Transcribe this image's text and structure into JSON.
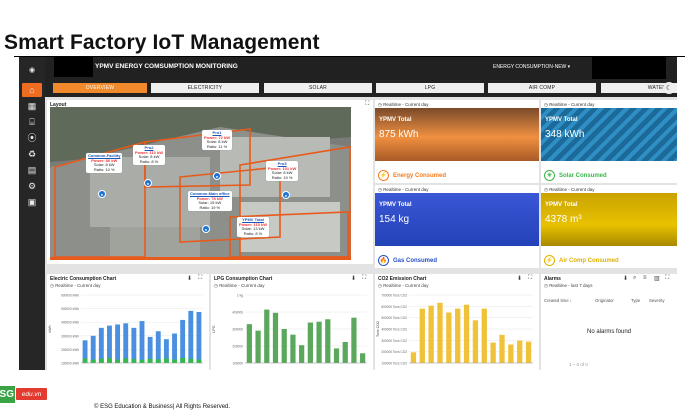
{
  "slide": {
    "title": "Smart Factory IoT Management",
    "footer": "© ESG Education & Business| All Rights Reserved.",
    "logo_sg": "SG",
    "logo_edu": "edu.vn"
  },
  "topbar": {
    "title": "YPMV ENERGY COMSUMPTION MONITORING",
    "dropdown": "ENERGY CONSUMPTION-NEW ▾",
    "menu": "⋮"
  },
  "tabs": [
    {
      "label": "OVERVIEW"
    },
    {
      "label": "ELECTRICITY"
    },
    {
      "label": "SOLAR"
    },
    {
      "label": "LPG"
    },
    {
      "label": "AIR COMP"
    },
    {
      "label": "WATER"
    }
  ],
  "layout": {
    "title": "Layout",
    "expand": "⛶"
  },
  "sites": [
    {
      "name": "Pro1",
      "lines": [
        "Power: 72 kW",
        "Solar: 8 kW",
        "Ratio: 11 %"
      ]
    },
    {
      "name": "Pro2",
      "lines": [
        "Power: 110 kW",
        "Solar: 8 kW",
        "Ratio: 8 %"
      ]
    },
    {
      "name": "Common-Facility",
      "lines": [
        "Power: 80 kW",
        "Solar: 8 kW",
        "Ratio: 10 %"
      ]
    },
    {
      "name": "Pro3",
      "lines": [
        "Power: 101 kW",
        "Solar: 8 kW",
        "Ratio: 19 %"
      ]
    },
    {
      "name": "Common-Main office",
      "lines": [
        "Power: 78 kW",
        "Solar: 15 kW",
        "Ratio: 19 %"
      ]
    },
    {
      "name": "YPMV Total",
      "lines": [
        "Power: 115 kW",
        "Solar: 13 kW",
        "Ratio: 8 %"
      ]
    }
  ],
  "tiles": [
    {
      "head": "Realtime - Current day",
      "title": "YPMV Total",
      "value": "875 kWh",
      "footer": "Energy Consumed",
      "color": "#f57c1e",
      "icon": "⚡"
    },
    {
      "head": "Realtime - Current day",
      "title": "YPMV Total",
      "value": "348 kWh",
      "footer": "Solar Consumed",
      "color": "#3cb54a",
      "icon": "☀"
    },
    {
      "head": "Realtime - Current day",
      "title": "YPMV Total",
      "value": "154 kg",
      "footer": "Gas Consumed",
      "color": "#2450c8",
      "icon": "🔥"
    },
    {
      "head": "Realtime - Current day",
      "title": "YPMV Total",
      "value": "4378 m³",
      "footer": "Air Comp Consumed",
      "color": "#f2c200",
      "icon": "⚡"
    }
  ],
  "charts": {
    "realtime_label": "Realtime - Current day",
    "elec": {
      "title": "Electric Consumption Chart",
      "ylabel": "kWh"
    },
    "lpg": {
      "title": "LPG Consumption Chart",
      "ylabel": "LPG"
    },
    "co2": {
      "title": "CO2 Emission Chart",
      "ylabel": "Tons CO2"
    },
    "download": "⬇",
    "fullscreen": "⛶"
  },
  "alarms": {
    "title": "Alarms",
    "sub": "Realtime - last 7 days",
    "columns": [
      "Created time ↓",
      "Originator",
      "Type",
      "Severity"
    ],
    "empty": "No alarms found",
    "pager": "1 – 0 of 0"
  },
  "chart_data": [
    {
      "type": "bar",
      "title": "Electric Consumption Chart",
      "ylabel": "kWh",
      "yticks": [
        "600000 kWh",
        "500000 kWh",
        "400000 kWh",
        "300000 kWh",
        "200000 kWh",
        "100000 kWh"
      ],
      "series": [
        {
          "values": [
            200000,
            240000,
            310000,
            330000,
            340000,
            350000,
            310000,
            370000,
            230000,
            280000,
            210000,
            260000,
            380000,
            460000,
            450000
          ]
        },
        {
          "values": [
            40000,
            30000,
            38000,
            45000,
            30000,
            42000,
            35000,
            28000,
            37000,
            33000,
            40000,
            30000,
            45000,
            38000,
            30000
          ]
        }
      ],
      "colors": [
        "#4a8fe0",
        "#34b94a"
      ],
      "ylim": [
        0,
        600000
      ]
    },
    {
      "type": "bar",
      "title": "LPG Consumption Chart",
      "ylabel": "LPG",
      "yticks": [
        "1 kg",
        "400000",
        "300000",
        "200000",
        "100000"
      ],
      "series": [
        {
          "values": [
            240000,
            200000,
            330000,
            310000,
            210000,
            175000,
            110000,
            250000,
            255000,
            270000,
            90000,
            130000,
            280000,
            60000
          ]
        }
      ],
      "colors": [
        "#5aa85c"
      ],
      "ylim": [
        0,
        420000
      ]
    },
    {
      "type": "bar",
      "title": "CO2 Emission Chart",
      "ylabel": "Tons CO2",
      "yticks": [
        "700000 Tons CO2",
        "600000 Tons CO2",
        "500000 Tons CO2",
        "400000 Tons CO2",
        "300000 Tons CO2",
        "200000 Tons CO2",
        "100000 Tons CO2"
      ],
      "series": [
        {
          "values": [
            110000,
            560000,
            590000,
            620000,
            520000,
            560000,
            600000,
            440000,
            560000,
            210000,
            290000,
            190000,
            230000,
            220000
          ]
        }
      ],
      "colors": [
        "#f0c23a"
      ],
      "ylim": [
        0,
        700000
      ]
    }
  ]
}
